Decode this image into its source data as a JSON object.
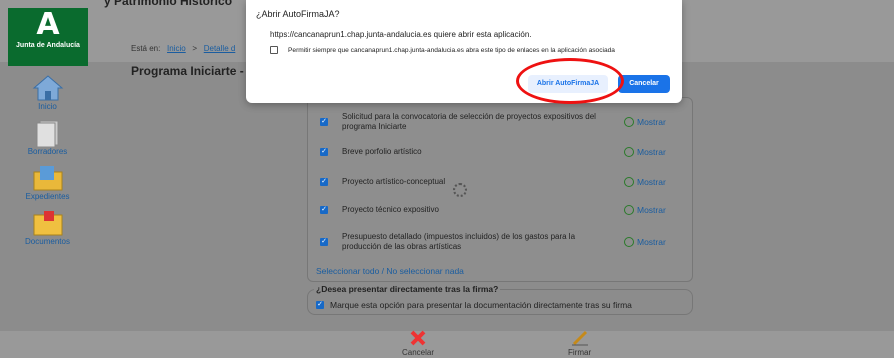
{
  "header": {
    "logo_text": "Junta de Andalucía",
    "title": "y Patrimonio Histórico"
  },
  "breadcrumb": {
    "prefix": "Está en:",
    "home": "Inicio",
    "sep": ">",
    "detail": "Detalle d"
  },
  "page_title": "Programa Iniciarte - Co",
  "sidebar": {
    "items": [
      {
        "label": "Inicio",
        "icon": "home-icon"
      },
      {
        "label": "Borradores",
        "icon": "drafts-icon"
      },
      {
        "label": "Expedientes",
        "icon": "folder-icon"
      },
      {
        "label": "Documentos",
        "icon": "documents-icon"
      }
    ]
  },
  "documents": {
    "rows": [
      {
        "text": "Solicitud para la convocatoria de selección de proyectos expositivos del programa Iniciarte",
        "action": "Mostrar",
        "checked": true
      },
      {
        "text": "Breve porfolio artístico",
        "action": "Mostrar",
        "checked": true
      },
      {
        "text": "Proyecto artístico-conceptual",
        "action": "Mostrar",
        "checked": true
      },
      {
        "text": "Proyecto técnico expositivo",
        "action": "Mostrar",
        "checked": true
      },
      {
        "text": "Presupuesto detallado (impuestos incluidos) de los gastos para la producción de las obras artísticas",
        "action": "Mostrar",
        "checked": true
      }
    ],
    "select_all": "Seleccionar todo / No seleccionar nada"
  },
  "firma": {
    "legend": "¿Desea presentar directamente tras la firma?",
    "option": "Marque esta opción para presentar la documentación directamente tras su firma",
    "checked": true
  },
  "bottom": {
    "cancel": "Cancelar",
    "sign": "Firmar"
  },
  "dialog": {
    "question": "¿Abrir AutoFirmaJA?",
    "url_text": "https://cancanaprun1.chap.junta-andalucia.es quiere abrir esta aplicación.",
    "checkbox_text": "Permitir siempre que cancanaprun1.chap.junta-andalucia.es abra este tipo de enlaces en la aplicación asociada",
    "open_button": "Abrir AutoFirmaJA",
    "cancel_button": "Cancelar"
  },
  "colors": {
    "accent": "#1a73e8",
    "annotation": "#e11111",
    "brand": "#0a6b2e"
  }
}
